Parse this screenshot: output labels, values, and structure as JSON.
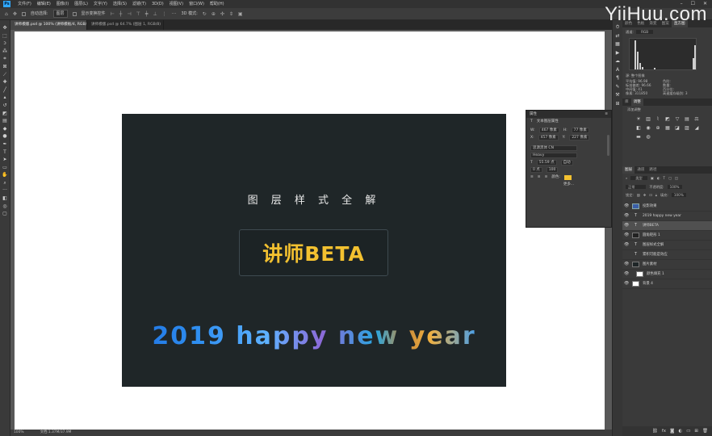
{
  "menubar": {
    "logo": "Ps",
    "items": [
      "文件(F)",
      "编辑(E)",
      "图像(I)",
      "图层(L)",
      "文字(Y)",
      "选择(S)",
      "滤镜(T)",
      "3D(D)",
      "视图(V)",
      "窗口(W)",
      "帮助(H)"
    ],
    "controls": [
      "–",
      "☐",
      "✕"
    ]
  },
  "options": {
    "autoselect": "自动选择:",
    "autoselect_value": "图层",
    "show_transform": "显示变换控件",
    "mode3d": "3D 模式:"
  },
  "tabs": [
    {
      "label": "讲师模版.psd @ 100% (讲师模板/4, RGB/8)",
      "active": true
    },
    {
      "label": "讲师模版.psd @ 64.7% (图层 1, RGB/8)",
      "active": false
    }
  ],
  "artboard": {
    "title": "图 层 样 式 全 解",
    "badge": "讲师BETA",
    "greeting": "2019 happy new  year"
  },
  "statusbar": {
    "zoom": "100%",
    "doc": "文档:1.37M/37.9M"
  },
  "properties": {
    "header": "属性",
    "title": "文本图层属性",
    "w_label": "W:",
    "w": "467 像素",
    "h_label": "H:",
    "h": "77 像素",
    "x_label": "X:",
    "x": "457 像素",
    "y_label": "Y:",
    "y": "227 像素",
    "font": "思源黑体 CN",
    "style": "Heavy",
    "size": "55.59 点",
    "leading": "自动",
    "tracking": "100",
    "kerning": "0 点",
    "color_label": "颜色:",
    "more": "更多..."
  },
  "panel_tabs_top": [
    "颜色",
    "色板",
    "渐变",
    "图案",
    "直方图"
  ],
  "histogram": {
    "channel_label": "通道:",
    "channel": "RGB",
    "source": "源: 整个图像",
    "stats": [
      "平均值: 96.98",
      "标准偏差: 96.66",
      "中间值: 41",
      "像素: 311850"
    ],
    "stats_right": [
      "色阶:",
      "数量:",
      "百分位:",
      "高速缓存级别: 3"
    ]
  },
  "adjust_tabs": [
    "库",
    "调整"
  ],
  "adjust_label": "添加调整",
  "layers_tabs": [
    "图层",
    "通道",
    "路径"
  ],
  "layers": {
    "filter_label": "类型",
    "blend": "正常",
    "opacity_label": "不透明度:",
    "opacity": "100%",
    "lock_label": "锁定:",
    "fill_label": "填充:",
    "fill": "100%",
    "items": [
      {
        "name": "投影效果",
        "icon": "img",
        "selected": false
      },
      {
        "name": "2019 happy new year",
        "icon": "T",
        "selected": false
      },
      {
        "name": "讲师BETA",
        "icon": "T",
        "selected": true
      },
      {
        "name": "圆角矩形 1",
        "icon": "img",
        "selected": false
      },
      {
        "name": "图层样式全解",
        "icon": "T",
        "selected": false
      },
      {
        "name": "累积可能是效应",
        "icon": "T",
        "selected": false
      },
      {
        "name": "图片素材",
        "icon": "img",
        "selected": false
      },
      {
        "name": "颜色填充 1",
        "icon": "img",
        "selected": false
      },
      {
        "name": "背景 4",
        "icon": "img",
        "selected": false
      }
    ]
  },
  "watermark": "YiiHuu.com",
  "colors": {
    "accent_yellow": "#f3c130",
    "artboard_bg": "#1f2628",
    "ui_dark": "#3a3a3a"
  }
}
